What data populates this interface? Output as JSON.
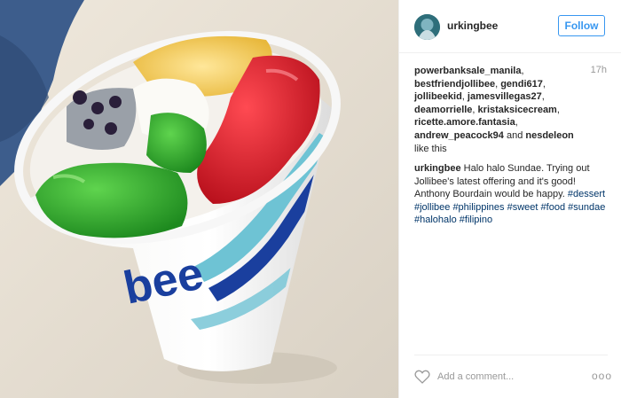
{
  "post": {
    "image_alt": "Halo halo sundae in a Jollibee cup",
    "cup_brand_text": "bee"
  },
  "header": {
    "username": "urkingbee",
    "follow_label": "Follow"
  },
  "likes": {
    "names": [
      "powerbanksale_manila",
      "bestfriendjollibee",
      "gendi617",
      "jollibeekid",
      "jamesvillegas27",
      "deamorrielle",
      "kristaksicecream",
      "ricette.amore.fantasia",
      "andrew_peacock94"
    ],
    "last_name": "nesdeleon",
    "connector": "and",
    "suffix": "like this"
  },
  "timestamp": "17h",
  "caption": {
    "username": "urkingbee",
    "text": "Halo halo Sundae. Trying out Jollibee's latest offering and it's good! Anthony Bourdain would be happy.",
    "hashtags": [
      "#dessert",
      "#jollibee",
      "#philippines",
      "#sweet",
      "#food",
      "#sundae",
      "#halohalo",
      "#filipino"
    ]
  },
  "footer": {
    "comment_placeholder": "Add a comment...",
    "more_label": "ooo"
  },
  "icons": {
    "like": "heart-icon",
    "more": "ellipsis-icon"
  },
  "colors": {
    "accent": "#3897f0",
    "hashtag": "#003569",
    "cup_blue": "#1a3f9e"
  }
}
